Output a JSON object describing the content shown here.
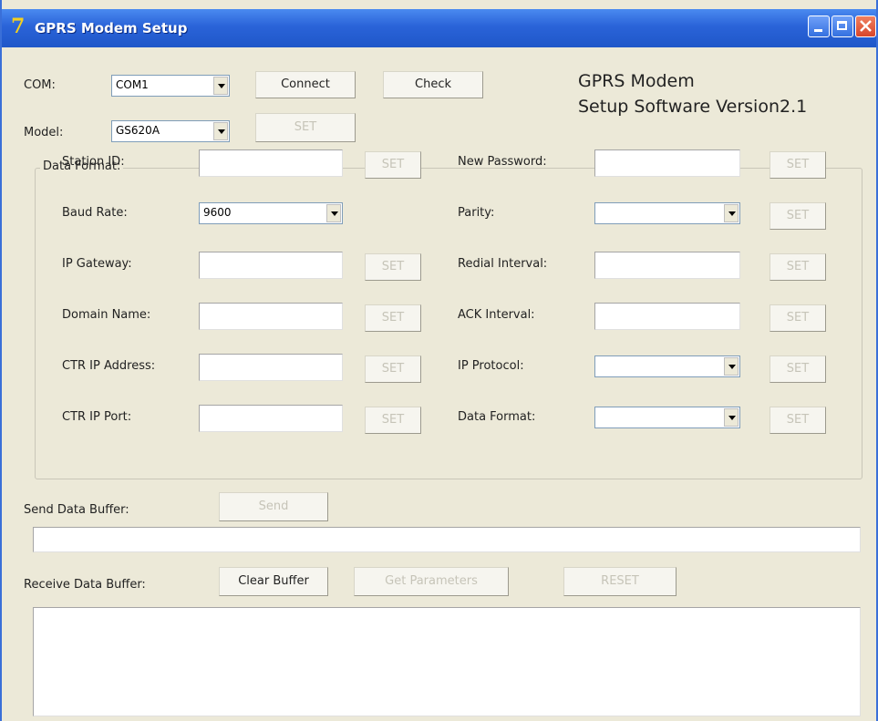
{
  "window": {
    "title": "GPRS Modem Setup",
    "logo": "7"
  },
  "header": {
    "com_label": "COM:",
    "com_value": "COM1",
    "model_label": "Model:",
    "model_value": "GS620A",
    "connect_label": "Connect",
    "check_label": "Check",
    "set_label": "SET",
    "software_title_line1": "GPRS Modem",
    "software_title_line2": "Setup Software Version2.1"
  },
  "data_format": {
    "group_label": "Data Format:",
    "left": [
      {
        "label": "Station ID:",
        "type": "text",
        "value": ""
      },
      {
        "label": "Baud Rate:",
        "type": "combo",
        "value": "9600"
      },
      {
        "label": "IP Gateway:",
        "type": "text",
        "value": ""
      },
      {
        "label": "Domain Name:",
        "type": "text",
        "value": ""
      },
      {
        "label": "CTR IP Address:",
        "type": "text",
        "value": ""
      },
      {
        "label": "CTR IP Port:",
        "type": "text",
        "value": ""
      }
    ],
    "right": [
      {
        "label": "New Password:",
        "type": "text",
        "value": ""
      },
      {
        "label": "Parity:",
        "type": "combo",
        "value": ""
      },
      {
        "label": "Redial  Interval:",
        "type": "text",
        "value": ""
      },
      {
        "label": "ACK Interval:",
        "type": "text",
        "value": ""
      },
      {
        "label": "IP Protocol:",
        "type": "combo",
        "value": ""
      },
      {
        "label": "Data Format:",
        "type": "combo",
        "value": ""
      }
    ],
    "set_label": "SET"
  },
  "send": {
    "label": "Send Data Buffer:",
    "send_button": "Send",
    "buffer_value": ""
  },
  "receive": {
    "label": "Receive Data  Buffer:",
    "clear_button": "Clear Buffer",
    "get_params_button": "Get Parameters",
    "reset_button": "RESET",
    "buffer_value": ""
  },
  "colors": {
    "titlebar": "#2a63d8",
    "window_bg": "#ece9d8",
    "disabled_text": "#c6c4b8"
  }
}
